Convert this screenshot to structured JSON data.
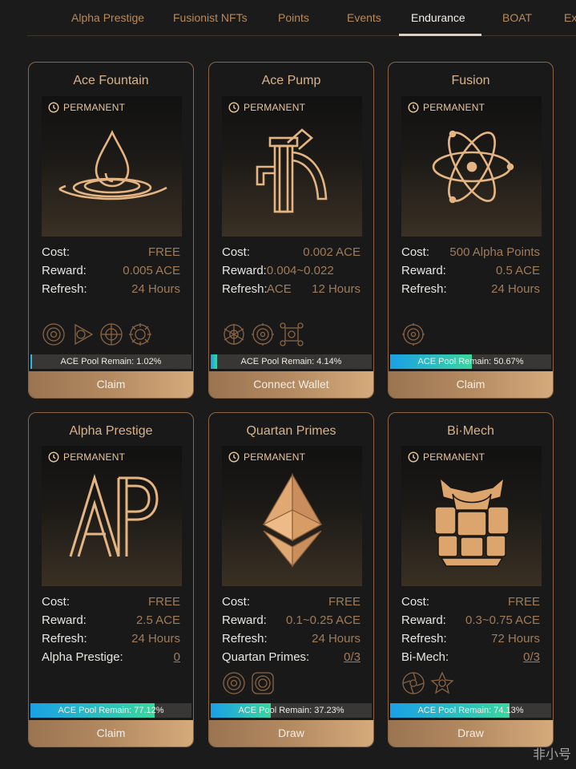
{
  "tabs": [
    "Alpha Prestige",
    "Fusionist NFTs",
    "Points",
    "Events",
    "Endurance",
    "BOAT",
    "Exp"
  ],
  "active_tab": "Endurance",
  "cards": [
    {
      "title": "Ace Fountain",
      "badge": "PERMANENT",
      "emblem": "water-drop-icon",
      "stats": [
        {
          "label": "Cost:",
          "value": "FREE"
        },
        {
          "label": "Reward:",
          "value": "0.005 ACE"
        },
        {
          "label": "Refresh:",
          "value": "24 Hours"
        }
      ],
      "requirement_icons": [
        "fountain-emblem-icon",
        "play-emblem-icon",
        "target-emblem-icon",
        "gear-emblem-icon"
      ],
      "pool_text": "ACE Pool Remain: 1.02%",
      "pool_fraction": 0.0102,
      "button": "Claim"
    },
    {
      "title": "Ace Pump",
      "badge": "PERMANENT",
      "emblem": "water-pump-icon",
      "stats": [
        {
          "label": "Cost:",
          "value": "0.002 ACE"
        },
        {
          "label": "Reward:",
          "value": "0.004~0.022 ACE"
        },
        {
          "label": "Refresh:",
          "value": "12 Hours"
        }
      ],
      "requirement_icons": [
        "snowflake-emblem-icon",
        "cog-emblem-icon",
        "chip-emblem-icon"
      ],
      "pool_text": "ACE Pool Remain: 4.14%",
      "pool_fraction": 0.0414,
      "button": "Connect Wallet"
    },
    {
      "title": "Fusion",
      "badge": "PERMANENT",
      "emblem": "atom-icon",
      "stats": [
        {
          "label": "Cost:",
          "value": "500 Alpha Points"
        },
        {
          "label": "Reward:",
          "value": "0.5 ACE"
        },
        {
          "label": "Refresh:",
          "value": "24 Hours"
        }
      ],
      "requirement_icons": [
        "cog-emblem-icon"
      ],
      "pool_text": "ACE Pool Remain: 50.67%",
      "pool_fraction": 0.5067,
      "button": "Claim"
    },
    {
      "title": "Alpha Prestige",
      "badge": "PERMANENT",
      "emblem": "ap-logo-icon",
      "stats": [
        {
          "label": "Cost:",
          "value": "FREE"
        },
        {
          "label": "Reward:",
          "value": "2.5 ACE"
        },
        {
          "label": "Refresh:",
          "value": "24 Hours"
        },
        {
          "label": "Alpha Prestige:",
          "value": "0",
          "link": true
        }
      ],
      "requirement_icons": [],
      "pool_text": "ACE Pool Remain: 77.12%",
      "pool_fraction": 0.7712,
      "button": "Claim"
    },
    {
      "title": "Quartan Primes",
      "badge": "PERMANENT",
      "emblem": "ethereum-diamond-icon",
      "stats": [
        {
          "label": "Cost:",
          "value": "FREE"
        },
        {
          "label": "Reward:",
          "value": "0.1~0.25 ACE"
        },
        {
          "label": "Refresh:",
          "value": "24 Hours"
        },
        {
          "label": "Quartan Primes:",
          "value": "0/3",
          "link": true
        }
      ],
      "requirement_icons": [
        "fountain-emblem-icon",
        "ring-emblem-icon"
      ],
      "pool_text": "ACE Pool Remain: 37.23%",
      "pool_fraction": 0.3723,
      "button": "Draw"
    },
    {
      "title": "Bi·Mech",
      "badge": "PERMANENT",
      "emblem": "mech-robot-icon",
      "stats": [
        {
          "label": "Cost:",
          "value": "FREE"
        },
        {
          "label": "Reward:",
          "value": "0.3~0.75 ACE"
        },
        {
          "label": "Refresh:",
          "value": "72 Hours"
        },
        {
          "label": "Bi-Mech:",
          "value": "0/3",
          "link": true
        }
      ],
      "requirement_icons": [
        "rotor-emblem-icon",
        "star-emblem-icon"
      ],
      "pool_text": "ACE Pool Remain: 74.13%",
      "pool_fraction": 0.7413,
      "button": "Draw"
    }
  ],
  "watermark": "非小号",
  "colors": {
    "gold": "#d8b38c",
    "card_border": "#8a6646",
    "pool_start": "#1aa0e6",
    "pool_end": "#3ad6a0"
  }
}
